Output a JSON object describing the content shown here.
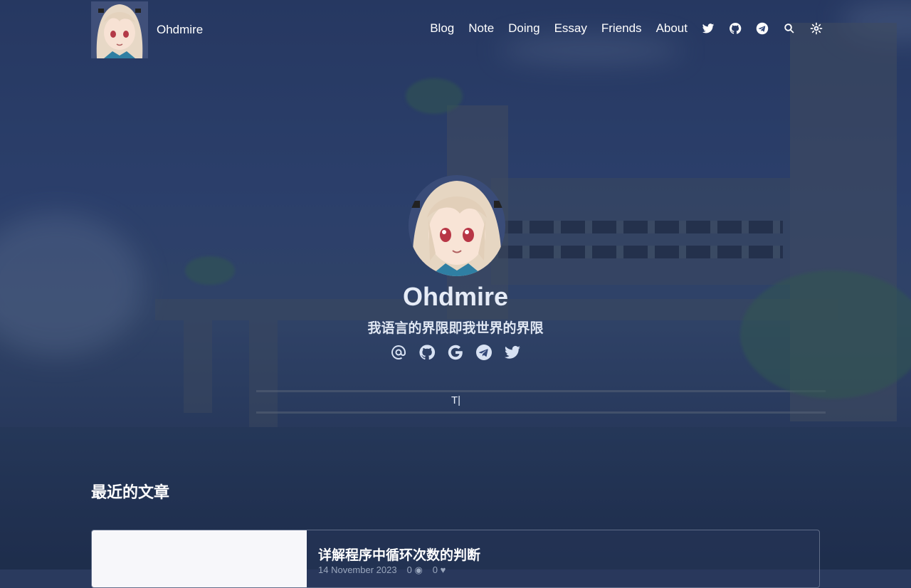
{
  "site": {
    "title": "Ohdmire"
  },
  "nav": {
    "links": [
      "Blog",
      "Note",
      "Doing",
      "Essay",
      "Friends",
      "About"
    ],
    "icons": [
      "twitter-icon",
      "github-icon",
      "telegram-icon",
      "search-icon",
      "theme-toggle-icon"
    ]
  },
  "hero": {
    "name": "Ohdmire",
    "motto": "我语言的界限即我世界的界限",
    "socials": [
      "email-icon",
      "github-icon",
      "google-icon",
      "telegram-icon",
      "twitter-icon"
    ],
    "cursor": "T|"
  },
  "recent": {
    "heading": "最近的文章",
    "posts": [
      {
        "title": "详解程序中循环次数的判断",
        "date": "14 November 2023",
        "views": "0",
        "likes": "0"
      }
    ]
  },
  "colors": {
    "accent_text": "#dfe6f2",
    "background": "#2c3e6b"
  }
}
